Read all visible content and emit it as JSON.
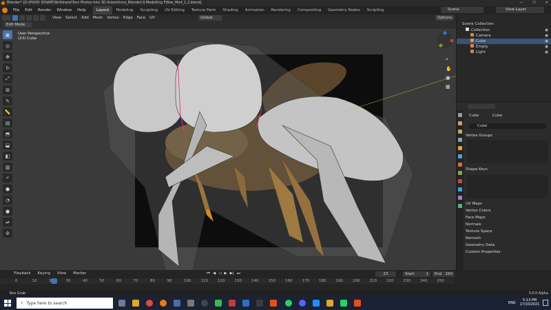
{
  "window": {
    "title": "Blender* [D:\\PIXXO 3D\\WIP\\Skillshare\\Turn Photos Into 3D Aniamtions_Blender\\3.Modelling F\\Bee_Mod_1.2.blend]"
  },
  "menu": [
    "File",
    "Edit",
    "Render",
    "Window",
    "Help"
  ],
  "workspaces": [
    "Layout",
    "Modeling",
    "Sculpting",
    "UV Editing",
    "Texture Paint",
    "Shading",
    "Animation",
    "Rendering",
    "Compositing",
    "Geometry Nodes",
    "Scripting"
  ],
  "active_workspace": "Layout",
  "scene": {
    "label": "Scene",
    "view_layer": "View Layer"
  },
  "viewport_header": {
    "mode": "Edit Mode",
    "menus": [
      "View",
      "Select",
      "Add",
      "Mesh",
      "Vertex",
      "Edge",
      "Face",
      "UV"
    ],
    "orientation": "Global",
    "options": "Options"
  },
  "viewport": {
    "perspective": "User Perspective",
    "object": "(23) Cube"
  },
  "outliner": {
    "title": "Scene Collection",
    "items": [
      {
        "label": "Collection",
        "indent": 1,
        "icon": "collection-icon"
      },
      {
        "label": "Camera",
        "indent": 2,
        "icon": "camera-icon"
      },
      {
        "label": "Cube",
        "indent": 2,
        "icon": "mesh-icon",
        "selected": true
      },
      {
        "label": "Empty",
        "indent": 2,
        "icon": "empty-icon"
      },
      {
        "label": "Light",
        "indent": 2,
        "icon": "light-icon"
      }
    ]
  },
  "properties": {
    "breadcrumb_object": "Cube",
    "breadcrumb_data": "Cube",
    "data_name": "Cube",
    "panels": [
      "Vertex Groups",
      "Shape Keys",
      "UV Maps",
      "Vertex Colors",
      "Face Maps",
      "Normals",
      "Texture Space",
      "Remesh",
      "Geometry Data",
      "Custom Properties"
    ]
  },
  "timeline": {
    "menus": [
      "Playback",
      "Keying",
      "View",
      "Marker"
    ],
    "current_frame": "23",
    "start_label": "Start",
    "start": "1",
    "end_label": "End",
    "end": "250",
    "ticks": [
      "0",
      "10",
      "20",
      "30",
      "40",
      "50",
      "60",
      "70",
      "80",
      "90",
      "100",
      "110",
      "120",
      "130",
      "140",
      "150",
      "160",
      "170",
      "180",
      "190",
      "200",
      "210",
      "220",
      "230",
      "240",
      "250"
    ]
  },
  "statusbar": {
    "left": "Box Grab",
    "right": "3.0.0 Alpha"
  },
  "taskbar": {
    "search_placeholder": "Type here to search",
    "lang": "ENG",
    "time": "5:13 PM",
    "date": "17/10/2021"
  }
}
